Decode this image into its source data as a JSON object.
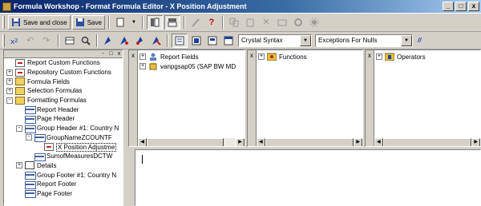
{
  "window": {
    "title": "Formula Workshop - Format Formula Editor - X Position Adjustment",
    "buttons": [
      "_",
      "□",
      "x"
    ]
  },
  "toolbar1": {
    "save_close_label": "Save and close",
    "save_label": "Save",
    "icons": [
      "save-close-icon",
      "save-icon",
      "new-icon",
      "dropdown-icon",
      "toggle-tree-icon",
      "toggle-fields-icon",
      "wizard-icon",
      "help-icon",
      "copy-icon",
      "paste-icon",
      "delete-icon",
      "rename-icon",
      "settings-icon",
      "gear-icon"
    ]
  },
  "toolbar2": {
    "syntax": "Crystal Syntax",
    "nulls": "Exceptions For Nulls",
    "comment_label": "//"
  },
  "tree": {
    "panel_buttons": [
      "-",
      "□",
      "x"
    ],
    "items": [
      {
        "label": "Report Custom Functions",
        "expander": "",
        "icon": "fx",
        "indent": 0
      },
      {
        "label": "Repository Custom Functions",
        "expander": "+",
        "icon": "fx",
        "indent": 0
      },
      {
        "label": "Formula Fields",
        "expander": "+",
        "icon": "folder",
        "indent": 0
      },
      {
        "label": "Selection Formulas",
        "expander": "+",
        "icon": "folder",
        "indent": 0
      },
      {
        "label": "Formatting Formulas",
        "expander": "-",
        "icon": "folder",
        "indent": 0
      },
      {
        "label": "Report Header",
        "expander": "",
        "icon": "line",
        "indent": 1
      },
      {
        "label": "Page Header",
        "expander": "",
        "icon": "line",
        "indent": 1
      },
      {
        "label": "Group Header #1: Country N",
        "expander": "-",
        "icon": "line",
        "indent": 1
      },
      {
        "label": "GroupNameZCOUNTF",
        "expander": "-",
        "icon": "line",
        "indent": 2
      },
      {
        "label": "X Position Adjustme",
        "expander": "",
        "icon": "fx",
        "indent": 3,
        "selected": true
      },
      {
        "label": "SumofMeasuresDCTW",
        "expander": "",
        "icon": "line",
        "indent": 2
      },
      {
        "label": "Details",
        "expander": "+",
        "icon": "doc",
        "indent": 1
      },
      {
        "label": "Group Footer #1: Country N",
        "expander": "",
        "icon": "line",
        "indent": 1
      },
      {
        "label": "Report Footer",
        "expander": "",
        "icon": "line",
        "indent": 1
      },
      {
        "label": "Page Footer",
        "expander": "",
        "icon": "line",
        "indent": 1
      }
    ]
  },
  "fields_pane": {
    "close": "x",
    "rows": [
      {
        "label": "Report Fields",
        "expander": "+"
      },
      {
        "label": "vanpgsap05 (SAP BW MD",
        "expander": "+"
      }
    ]
  },
  "functions_pane": {
    "close": "x",
    "rows": [
      {
        "label": "Functions",
        "expander": "+"
      }
    ]
  },
  "operators_pane": {
    "close": "x",
    "rows": [
      {
        "label": "Operators",
        "expander": "+"
      }
    ]
  },
  "colors": {
    "title_start": "#0a246a",
    "title_end": "#a6caf0",
    "chrome": "#d4d0c8"
  }
}
